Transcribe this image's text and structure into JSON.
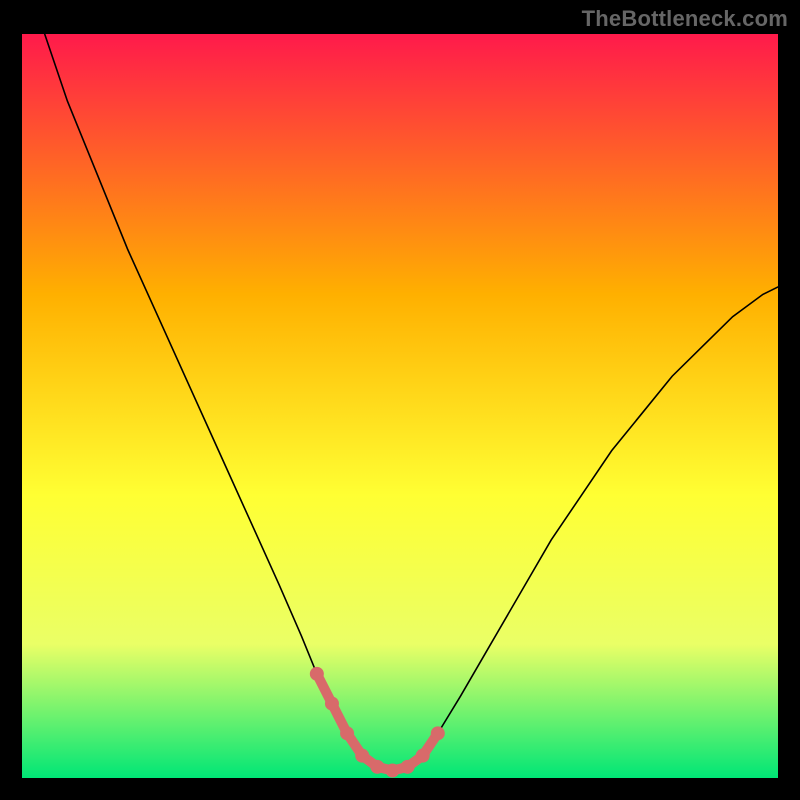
{
  "watermark": "TheBottleneck.com",
  "chart_data": {
    "type": "line",
    "title": "",
    "xlabel": "",
    "ylabel": "",
    "xlim": [
      0,
      100
    ],
    "ylim": [
      0,
      100
    ],
    "background_gradient": {
      "top": "#ff1a4b",
      "mid_upper": "#ffb000",
      "mid": "#ffff33",
      "mid_lower": "#eaff66",
      "bottom": "#00e676"
    },
    "series": [
      {
        "name": "bottleneck-curve",
        "x": [
          3,
          6,
          10,
          14,
          18,
          22,
          26,
          30,
          34,
          37,
          39,
          41,
          43,
          45,
          47,
          49,
          51,
          53,
          55,
          58,
          62,
          66,
          70,
          74,
          78,
          82,
          86,
          90,
          94,
          98,
          100
        ],
        "y": [
          100,
          91,
          81,
          71,
          62,
          53,
          44,
          35,
          26,
          19,
          14,
          10,
          6,
          3,
          1.5,
          1,
          1.5,
          3,
          6,
          11,
          18,
          25,
          32,
          38,
          44,
          49,
          54,
          58,
          62,
          65,
          66
        ],
        "color": "#000000",
        "width": 1.6
      },
      {
        "name": "bottom-highlight",
        "x": [
          39,
          41,
          43,
          45,
          47,
          49,
          51,
          53,
          55
        ],
        "y": [
          14,
          10,
          6,
          3,
          1.5,
          1,
          1.5,
          3,
          6
        ],
        "color": "#d86a6a",
        "width": 10,
        "markers": true
      }
    ]
  }
}
